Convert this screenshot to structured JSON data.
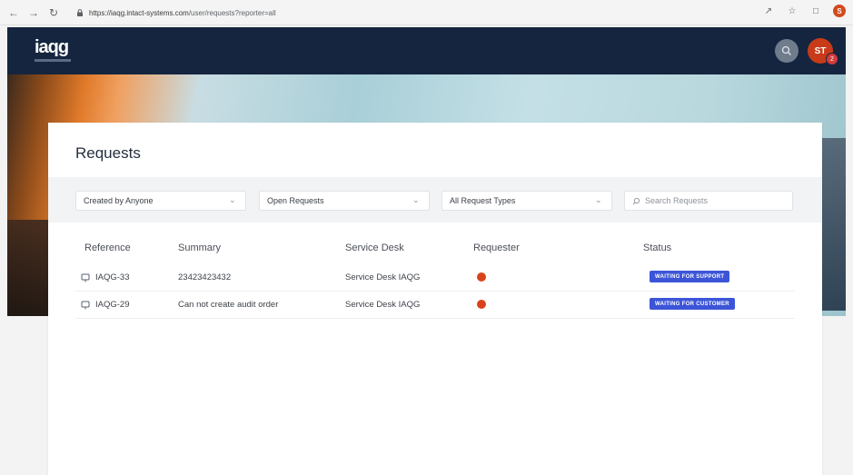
{
  "browser": {
    "url_host": "https://iaqg.intact-systems.com",
    "url_path": "/user/requests?reporter=all",
    "profile_initial": "S"
  },
  "header": {
    "logo": "iaqg",
    "avatar_initials": "ST",
    "avatar_badge": "2",
    "search_icon": "search-icon"
  },
  "page": {
    "title": "Requests"
  },
  "filters": {
    "created_by": "Created by Anyone",
    "status": "Open Requests",
    "request_type": "All Request Types",
    "search_placeholder": "Search Requests"
  },
  "table": {
    "columns": [
      "Reference",
      "Summary",
      "Service Desk",
      "Requester",
      "Status"
    ],
    "rows": [
      {
        "reference": "IAQG-33",
        "summary": "23423423432",
        "service_desk": "Service Desk IAQG",
        "status": "WAITING FOR SUPPORT"
      },
      {
        "reference": "IAQG-29",
        "summary": "Can not create audit order",
        "service_desk": "Service Desk IAQG",
        "status": "WAITING FOR CUSTOMER"
      }
    ]
  },
  "colors": {
    "header_bg": "#15253f",
    "status_badge": "#3c55d8",
    "requester_dot": "#d9431c",
    "avatar": "#c83b19"
  }
}
